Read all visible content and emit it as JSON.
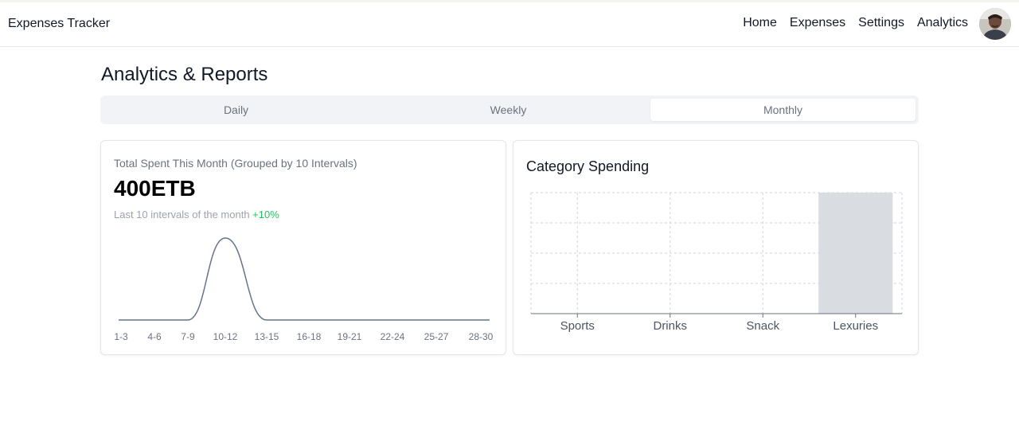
{
  "header": {
    "brand": "Expenses Tracker",
    "nav": [
      "Home",
      "Expenses",
      "Settings",
      "Analytics"
    ]
  },
  "main": {
    "title": "Analytics & Reports",
    "tabs": [
      {
        "label": "Daily",
        "active": false
      },
      {
        "label": "Weekly",
        "active": false
      },
      {
        "label": "Monthly",
        "active": true
      }
    ]
  },
  "summary": {
    "subtitle": "Total Spent This Month (Grouped by 10 Intervals)",
    "amount": "400ETB",
    "note": "Last 10 intervals of the month",
    "change": "+10%"
  },
  "category": {
    "title": "Category Spending"
  },
  "colors": {
    "line": "#64748b",
    "bar": "#d9dde2",
    "positive": "#22c55e"
  },
  "chart_data": [
    {
      "type": "line",
      "categories": [
        "1-3",
        "4-6",
        "7-9",
        "10-12",
        "13-15",
        "16-18",
        "19-21",
        "22-24",
        "25-27",
        "28-30"
      ],
      "values": [
        0,
        0,
        0,
        400,
        0,
        0,
        0,
        0,
        0,
        0
      ],
      "ylim": [
        0,
        400
      ],
      "grid": false
    },
    {
      "type": "bar",
      "categories": [
        "Sports",
        "Drinks",
        "Snack",
        "Lexuries"
      ],
      "values": [
        0,
        0,
        0,
        400
      ],
      "ylim": [
        0,
        400
      ],
      "grid": true
    }
  ]
}
